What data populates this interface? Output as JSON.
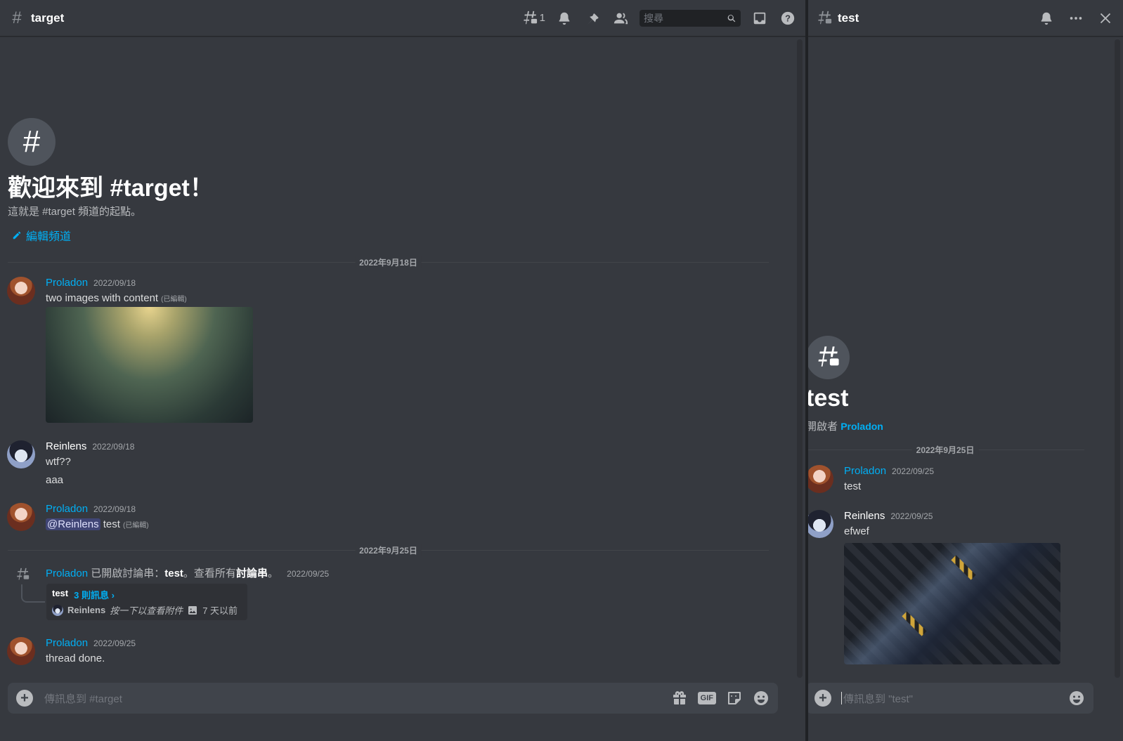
{
  "main": {
    "channel": "target",
    "thread_count": "1",
    "search_placeholder": "搜尋",
    "welcome_title": "歡迎來到 #target！",
    "welcome_sub": "這就是 #target 頻道的起點。",
    "edit_channel": "編輯頻道",
    "dividers": [
      "2022年9月18日",
      "2022年9月25日"
    ],
    "messages": [
      {
        "author": "Proladon",
        "time": "2022/09/18",
        "text": "two images with content",
        "edited": "(已編輯)"
      },
      {
        "author": "Reinlens",
        "time": "2022/09/18",
        "lines": [
          "wtf??",
          "aaa"
        ]
      },
      {
        "author": "Proladon",
        "time": "2022/09/18",
        "mention": "@Reinlens",
        "text": "test",
        "edited": "(已編輯)"
      },
      {
        "author": "Proladon",
        "time": "2022/09/25",
        "text": "thread done."
      }
    ],
    "thread_event": {
      "author": "Proladon",
      "pre": "已開啟討論串：",
      "thread": "test",
      "mid": "。查看所有",
      "all": "討論串",
      "post": "。",
      "time": "2022/09/25",
      "card_title": "test",
      "card_count": "3 則訊息 ›",
      "card_author": "Reinlens",
      "card_text": "按一下以查看附件",
      "card_time": "7 天以前"
    },
    "composer_placeholder": "傳訊息到 #target",
    "gif_label": "GIF"
  },
  "side": {
    "thread": "test",
    "title": "test",
    "opened_by": "開啟者",
    "opener": "Proladon",
    "divider": "2022年9月25日",
    "messages": [
      {
        "author": "Proladon",
        "time": "2022/09/25",
        "text": "test"
      },
      {
        "author": "Reinlens",
        "time": "2022/09/25",
        "text": "efwef"
      }
    ],
    "composer_placeholder": "傳訊息到 \"test\""
  },
  "colors": {
    "accent": "#00aff4",
    "bg": "#36393f",
    "sidebar": "#202225"
  }
}
